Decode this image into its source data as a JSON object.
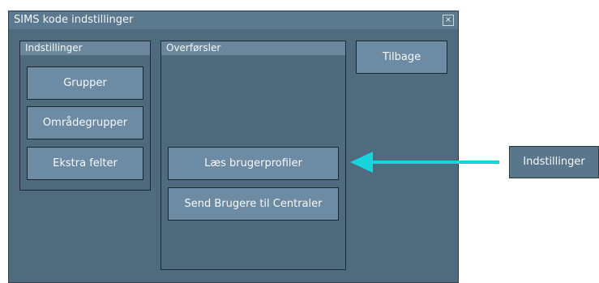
{
  "window": {
    "title": "SIMS kode indstillinger",
    "close_glyph": "×"
  },
  "settings_group": {
    "title": "Indstillinger",
    "buttons": [
      "Grupper",
      "Områdegrupper",
      "Ekstra felter"
    ]
  },
  "transfers_group": {
    "title": "Overførsler",
    "buttons": [
      "Læs brugerprofiler",
      "Send Brugere til Centraler"
    ]
  },
  "back_button": "Tilbage",
  "external_button": "Indstillinger",
  "colors": {
    "arrow": "#19d3dd",
    "window_bg": "#4f6b7e",
    "button_bg": "#6d8ca3"
  }
}
